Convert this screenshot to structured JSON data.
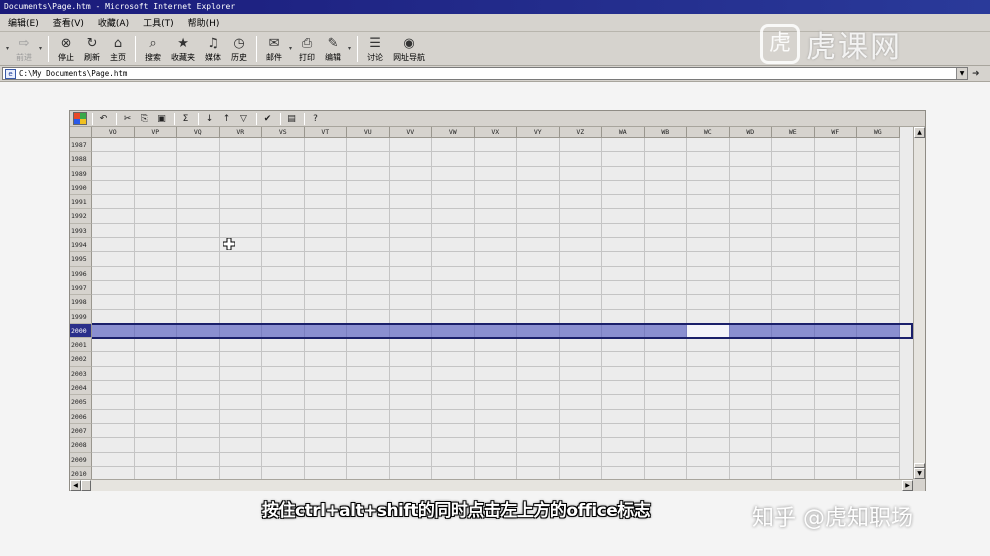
{
  "window": {
    "title": "Documents\\Page.htm - Microsoft Internet Explorer"
  },
  "menu": {
    "items": [
      "编辑(E)",
      "查看(V)",
      "收藏(A)",
      "工具(T)",
      "帮助(H)"
    ]
  },
  "toolbar": {
    "buttons": [
      {
        "label": "前进",
        "icon": "forward-arrow-icon",
        "enabled": false
      },
      {
        "label": "停止",
        "icon": "stop-icon",
        "enabled": true
      },
      {
        "label": "刷新",
        "icon": "refresh-icon",
        "enabled": true
      },
      {
        "label": "主页",
        "icon": "home-icon",
        "enabled": true
      },
      {
        "label": "搜索",
        "icon": "search-icon",
        "enabled": true
      },
      {
        "label": "收藏夹",
        "icon": "favorites-icon",
        "enabled": true
      },
      {
        "label": "媒体",
        "icon": "media-icon",
        "enabled": true
      },
      {
        "label": "历史",
        "icon": "history-icon",
        "enabled": true
      },
      {
        "label": "邮件",
        "icon": "mail-icon",
        "enabled": true
      },
      {
        "label": "打印",
        "icon": "print-icon",
        "enabled": true
      },
      {
        "label": "编辑",
        "icon": "edit-icon",
        "enabled": true
      },
      {
        "label": "讨论",
        "icon": "discuss-icon",
        "enabled": true
      },
      {
        "label": "网址导航",
        "icon": "url-navigation-icon",
        "enabled": true
      }
    ]
  },
  "address": {
    "value": "C:\\My Documents\\Page.htm"
  },
  "spreadsheet": {
    "toolbar_icons": [
      "office-logo-icon",
      "undo-icon",
      "cut-icon",
      "copy-icon",
      "paste-icon",
      "autosum-icon",
      "sort-ascending-icon",
      "sort-descending-icon",
      "autofilter-icon",
      "export-to-excel-icon",
      "property-toolbox-icon",
      "help-icon"
    ],
    "columns": [
      "VO",
      "VP",
      "VQ",
      "VR",
      "VS",
      "VT",
      "VU",
      "VV",
      "VW",
      "VX",
      "VY",
      "VZ",
      "WA",
      "WB",
      "WC",
      "WD",
      "WE",
      "WF",
      "WG"
    ],
    "rows": [
      "1987",
      "1988",
      "1989",
      "1990",
      "1991",
      "1992",
      "1993",
      "1994",
      "1995",
      "1996",
      "1997",
      "1998",
      "1999",
      "2000",
      "2001",
      "2002",
      "2003",
      "2004",
      "2005",
      "2006",
      "2007",
      "2008",
      "2009",
      "2010"
    ],
    "selected_row": "2000",
    "active_cell": "WC2000",
    "selection_color": "#8a8fd0"
  },
  "subtitle": "按住ctrl+alt+shift的同时点击左上方的office标志",
  "watermark": {
    "bottom": "知乎 @虎知职场",
    "top_mark": "虎",
    "top_text": "虎课网"
  }
}
